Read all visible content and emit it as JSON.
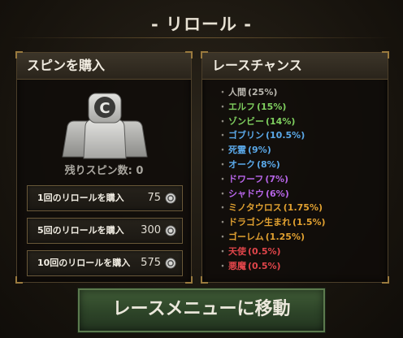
{
  "title": "- リロール -",
  "spin_panel": {
    "header": "スピンを購入",
    "remaining_label": "残りスピン数:",
    "remaining_value": "0",
    "buy_options": [
      {
        "label": "1回のリロールを購入",
        "cost": "75"
      },
      {
        "label": "5回のリロールを購入",
        "cost": "300"
      },
      {
        "label": "10回のリロールを購入",
        "cost": "575"
      }
    ]
  },
  "race_panel": {
    "header": "レースチャンス",
    "bullet": "・",
    "races": [
      {
        "name": "人間",
        "pct": "(25%)",
        "color": "#b9b6ae"
      },
      {
        "name": "エルフ",
        "pct": "(15%)",
        "color": "#7fcf5f"
      },
      {
        "name": "ゾンビー",
        "pct": "(14%)",
        "color": "#7fcf5f"
      },
      {
        "name": "ゴブリン",
        "pct": "(10.5%)",
        "color": "#5aa8e8"
      },
      {
        "name": "死霊",
        "pct": "(9%)",
        "color": "#5aa8e8"
      },
      {
        "name": "オーク",
        "pct": "(8%)",
        "color": "#5aa8e8"
      },
      {
        "name": "ドワーフ",
        "pct": "(7%)",
        "color": "#b765e8"
      },
      {
        "name": "シャドウ",
        "pct": "(6%)",
        "color": "#b765e8"
      },
      {
        "name": "ミノタウロス",
        "pct": "(1.75%)",
        "color": "#e0a030"
      },
      {
        "name": "ドラゴン生まれ",
        "pct": "(1.5%)",
        "color": "#e0a030"
      },
      {
        "name": "ゴーレム",
        "pct": "(1.25%)",
        "color": "#e0a030"
      },
      {
        "name": "天使",
        "pct": "(0.5%)",
        "color": "#e0454a"
      },
      {
        "name": "悪魔",
        "pct": "(0.5%)",
        "color": "#e0454a"
      }
    ]
  },
  "move_button": "レースメニューに移動"
}
